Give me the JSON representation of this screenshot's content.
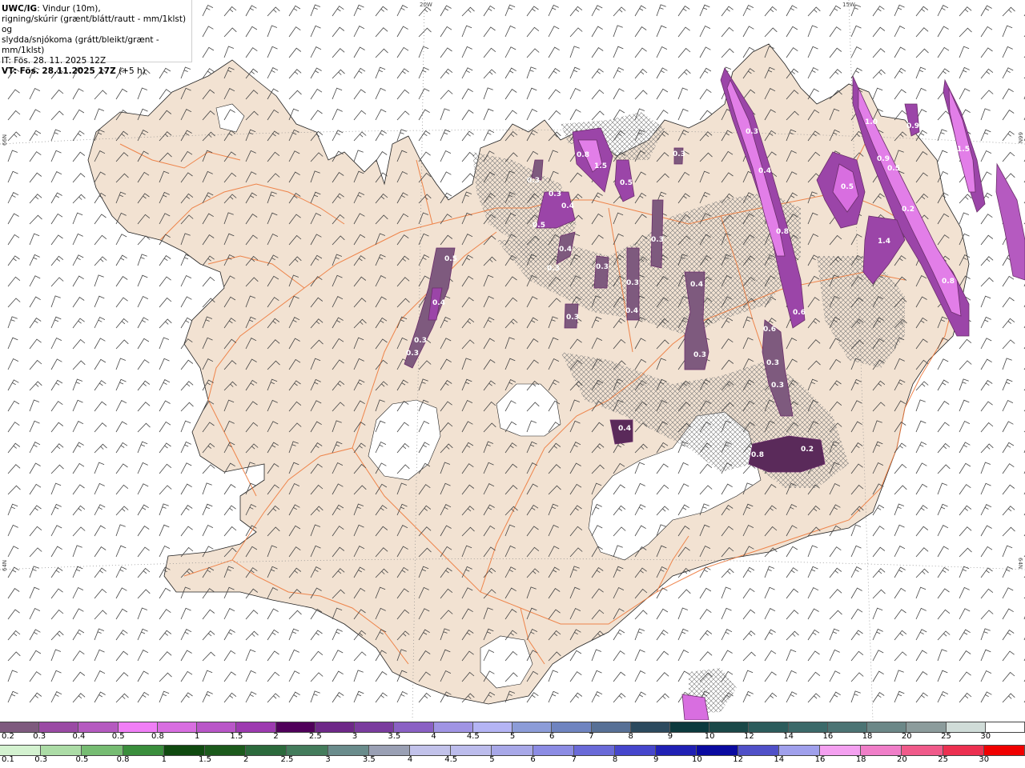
{
  "title": {
    "model": "UWC/IG",
    "line1_rest": ": Vindur (10m),",
    "line2": "rigning/skúrir (grænt/blátt/rautt - mm/1klst) og",
    "line3": "slydda/snjókoma (grátt/bleikt/grænt - mm/1klst)",
    "it_line": "IT: Fös. 28. 11. 2025 12Z",
    "vt_bold": "VT: Fös. 28.11.2025 17Z",
    "vt_rest": " (+5 h)"
  },
  "coords": {
    "top_20w": "20W",
    "top_15w": "15W",
    "left_66n": "66N",
    "left_64n": "64N",
    "right_66n": "66N",
    "right_64n": "64N"
  },
  "colors": {
    "land": "#f2e2d2",
    "coast": "#222222",
    "roads": "#ee7a3c",
    "precip_dark": "#5a2a5a",
    "precip_mid": "#9b45a8",
    "precip_light": "#e27ee8",
    "precip_outline": "#c667d0"
  },
  "snow_labels": [
    "0.8",
    "1.5",
    "0.5",
    "0.3",
    "0.3",
    "0.4",
    "0.5",
    "0.4",
    "0.3",
    "0.3",
    "0.3",
    "0.4",
    "0.3",
    "0.3",
    "0.3",
    "0.3",
    "0.4",
    "0.8",
    "0.6",
    "0.6",
    "0.3",
    "0.3",
    "0.5",
    "0.5",
    "0.9",
    "0.9",
    "0.2",
    "1.4",
    "0.8",
    "1.5",
    "1.0",
    "0.8",
    "0.2",
    "0.4",
    "0.3",
    "0.5",
    "0.4",
    "0.3",
    "0.3",
    "0.4"
  ],
  "legend_snow": {
    "labels": [
      "0.2",
      "0.3",
      "0.4",
      "0.5",
      "0.8",
      "1",
      "1.5",
      "2",
      "2.5",
      "3",
      "3.5",
      "4",
      "4.5",
      "5",
      "6",
      "7",
      "8",
      "9",
      "10",
      "12",
      "14",
      "16",
      "18",
      "20",
      "25",
      "30"
    ],
    "colors": [
      "#7e5a7e",
      "#9a4aa4",
      "#b55ac0",
      "#f07ef6",
      "#d86ee0",
      "#b956c8",
      "#9d3ab0",
      "#50005a",
      "#6e2888",
      "#7a3b9e",
      "#8a60c4",
      "#a094e4",
      "#b4b4f4",
      "#8c9cd8",
      "#6f84c0",
      "#577096",
      "#2c4a5e",
      "#0c3a3e",
      "#1a4848",
      "#2c5c5c",
      "#3c6a6a",
      "#4c7474",
      "#6c8888",
      "#8c9c9c",
      "#d0dcd8",
      "#ffffff"
    ]
  },
  "legend_rain": {
    "labels": [
      "0.1",
      "0.3",
      "0.5",
      "0.8",
      "1",
      "1.5",
      "2",
      "2.5",
      "3",
      "3.5",
      "4",
      "4.5",
      "5",
      "6",
      "7",
      "8",
      "9",
      "10",
      "12",
      "14",
      "16",
      "18",
      "20",
      "25",
      "30"
    ],
    "colors": [
      "#d4f2d0",
      "#acdca6",
      "#76bc72",
      "#3a8e3c",
      "#104a10",
      "#1c5a1c",
      "#2c6a3c",
      "#447c5c",
      "#6a8c8c",
      "#9aa0b4",
      "#c2c2ea",
      "#bcbcec",
      "#a8a8e8",
      "#8c8ce4",
      "#6a6ad8",
      "#4646cc",
      "#2020b4",
      "#0a0aa0",
      "#5050c8",
      "#a0a0ec",
      "#f4a0f0",
      "#f07ec8",
      "#f05a8a",
      "#ec3050",
      "#f00000"
    ]
  }
}
